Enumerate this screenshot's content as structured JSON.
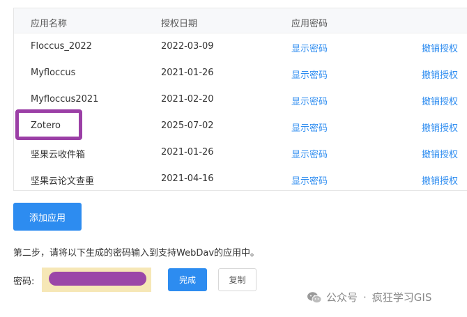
{
  "table": {
    "headers": [
      "应用名称",
      "授权日期",
      "应用密码"
    ],
    "rows": [
      {
        "name": "Floccus_2022",
        "date": "2022-03-09",
        "show": "显示密码",
        "revoke": "撤销授权"
      },
      {
        "name": "Myfloccus",
        "date": "2021-01-26",
        "show": "显示密码",
        "revoke": "撤销授权"
      },
      {
        "name": "Myfloccus2021",
        "date": "2021-02-20",
        "show": "显示密码",
        "revoke": "撤销授权"
      },
      {
        "name": "Zotero",
        "date": "2025-07-02",
        "show": "显示密码",
        "revoke": "撤销授权"
      },
      {
        "name": "坚果云收件箱",
        "date": "2021-01-26",
        "show": "显示密码",
        "revoke": "撤销授权"
      },
      {
        "name": "坚果云论文查重",
        "date": "2021-04-16",
        "show": "显示密码",
        "revoke": "撤销授权"
      }
    ]
  },
  "add_app_label": "添加应用",
  "step_two_text": "第二步，请将以下生成的密码输入到支持WebDav的应用中。",
  "password": {
    "label": "密码:",
    "done_label": "完成",
    "copy_label": "复制"
  },
  "watermark": {
    "source": "公众号",
    "separator": "·",
    "name": "疯狂学习GIS"
  },
  "colors": {
    "link": "#2d8cf0",
    "primary": "#2d8cf0",
    "highlight": "#9b3fa6",
    "redaction": "#9b46a8"
  }
}
